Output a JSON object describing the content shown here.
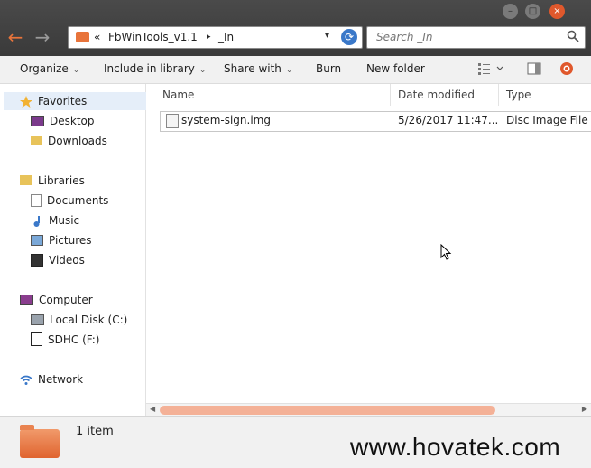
{
  "window": {
    "min_label": "–",
    "max_label": "□",
    "close_label": "×"
  },
  "nav": {
    "back_icon": "←",
    "forward_icon": "→"
  },
  "address": {
    "overflow": "«",
    "crumb1": "FbWinTools_v1.1",
    "sep": "▸",
    "crumb2": "_In",
    "dropdown": "▾",
    "refresh": "⟳"
  },
  "search": {
    "placeholder": "Search _In"
  },
  "toolbar": {
    "organize": "Organize",
    "include": "Include in library",
    "share": "Share with",
    "burn": "Burn",
    "new_folder": "New folder",
    "caret": "⌄"
  },
  "sidebar": {
    "favorites": "Favorites",
    "desktop": "Desktop",
    "downloads": "Downloads",
    "libraries": "Libraries",
    "documents": "Documents",
    "music": "Music",
    "pictures": "Pictures",
    "videos": "Videos",
    "computer": "Computer",
    "local_disk": "Local Disk (C:)",
    "sdhc": "SDHC (F:)",
    "network": "Network"
  },
  "columns": {
    "name": "Name",
    "date": "Date modified",
    "type": "Type"
  },
  "files": [
    {
      "name": "system-sign.img",
      "date": "5/26/2017 11:47...",
      "type": "Disc Image File"
    }
  ],
  "status": {
    "count": "1 item"
  },
  "watermark": "www.hovatek.com",
  "colors": {
    "accent": "#e8743b",
    "selection": "#e5eef9",
    "scroll_thumb": "#f4b197"
  }
}
